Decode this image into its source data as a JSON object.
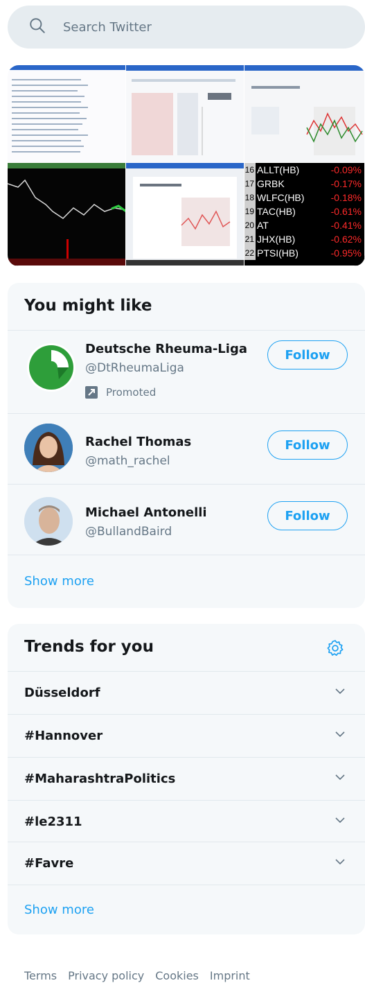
{
  "search": {
    "placeholder": "Search Twitter"
  },
  "media": {
    "stocks": [
      {
        "num": "16",
        "symbol": "ALLT(HB)",
        "change": "-0.09%"
      },
      {
        "num": "17",
        "symbol": "GRBK",
        "change": "-0.17%"
      },
      {
        "num": "18",
        "symbol": "WLFC(HB)",
        "change": "-0.18%"
      },
      {
        "num": "19",
        "symbol": "TAC(HB)",
        "change": "-0.61%"
      },
      {
        "num": "20",
        "symbol": "AT",
        "change": "-0.41%"
      },
      {
        "num": "21",
        "symbol": "JHX(HB)",
        "change": "-0.62%"
      },
      {
        "num": "22",
        "symbol": "PTSI(HB)",
        "change": "-0.95%"
      }
    ]
  },
  "you_might_like": {
    "title": "You might like",
    "users": [
      {
        "name": "Deutsche Rheuma-Liga",
        "handle": "@DtRheumaLiga",
        "promoted": "Promoted",
        "follow": "Follow"
      },
      {
        "name": "Rachel Thomas",
        "handle": "@math_rachel",
        "follow": "Follow"
      },
      {
        "name": "Michael Antonelli",
        "handle": "@BullandBaird",
        "follow": "Follow"
      }
    ],
    "show_more": "Show more"
  },
  "trends": {
    "title": "Trends for you",
    "items": [
      "Düsseldorf",
      "#Hannover",
      "#MaharashtraPolitics",
      "#le2311",
      "#Favre"
    ],
    "show_more": "Show more"
  },
  "footer": {
    "links": [
      "Terms",
      "Privacy policy",
      "Cookies",
      "Imprint"
    ]
  },
  "colors": {
    "accent": "#1da1f2",
    "card_bg": "#f5f8fa",
    "search_bg": "#e6ecf0"
  }
}
